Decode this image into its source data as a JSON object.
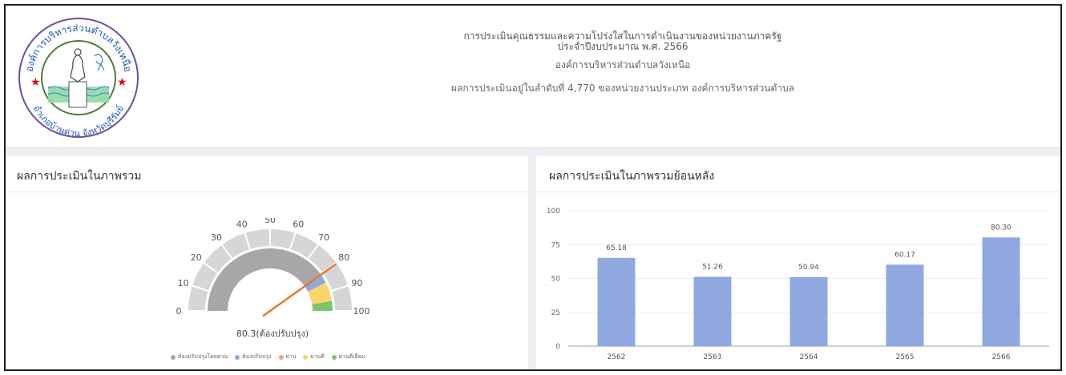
{
  "header": {
    "line1": "การประเมินคุณธรรมและความโปร่งใสในการดำเนินงานของหน่วยงานภาครัฐ",
    "line2": "ประจำปีงบประมาณ พ.ศ. 2566",
    "org_name": "องค์การบริหารส่วนตำบลวังเหนือ",
    "ranking": "ผลการประเมินอยู่ในลำดับที่ 4,770 ของหน่วยงานประเภท องค์การบริหารส่วนตำบล"
  },
  "logo": {
    "top_text": "องค์การบริหารส่วนตำบลวังเหนือ",
    "bottom_text": "อำเภอบ้านด่าน จังหวัดบุรีรัมย์"
  },
  "overall_panel": {
    "title": "ผลการประเมินในภาพรวม",
    "score_label": "80.3(ต้องปรับปรุง)",
    "score": 80.3,
    "ticks": [
      "0",
      "10",
      "20",
      "30",
      "40",
      "50",
      "60",
      "70",
      "80",
      "90",
      "100"
    ],
    "legend": [
      {
        "label": "ต้องปรับปรุงโดยด่วน",
        "color": "#a8a6a8"
      },
      {
        "label": "ต้องปรับปรุง",
        "color": "#8fa8e0"
      },
      {
        "label": "ผ่าน",
        "color": "#f2a77a"
      },
      {
        "label": "ผ่านดี",
        "color": "#f9d56a"
      },
      {
        "label": "ผ่านดีเยี่ยม",
        "color": "#7cc36b"
      }
    ]
  },
  "history_panel": {
    "title": "ผลการประเมินในภาพรวมย้อนหลัง"
  },
  "chart_data": [
    {
      "type": "gauge",
      "value": 80.3,
      "range": [
        0,
        100
      ],
      "bands": [
        {
          "from": 0,
          "to": 80,
          "label": "ต้องปรับปรุงโดยด่วน",
          "color": "#a8a6a8"
        },
        {
          "from": 80,
          "to": 85,
          "label": "ต้องปรับปรุง",
          "color": "#8fa8e0"
        },
        {
          "from": 85,
          "to": 95,
          "label": "ผ่านดี",
          "color": "#f9d56a"
        },
        {
          "from": 95,
          "to": 100,
          "label": "ผ่านดีเยี่ยม",
          "color": "#7cc36b"
        }
      ]
    },
    {
      "type": "bar",
      "categories": [
        "2562",
        "2563",
        "2564",
        "2565",
        "2566"
      ],
      "values": [
        65.18,
        51.26,
        50.94,
        60.17,
        80.3
      ],
      "value_labels": [
        "65.18",
        "51.26",
        "50.94",
        "60.17",
        "80.30"
      ],
      "ylim": [
        0,
        100
      ],
      "yticks": [
        "0",
        "25",
        "50",
        "75",
        "100"
      ],
      "grid": true,
      "bar_color": "#8fa8e0"
    }
  ]
}
